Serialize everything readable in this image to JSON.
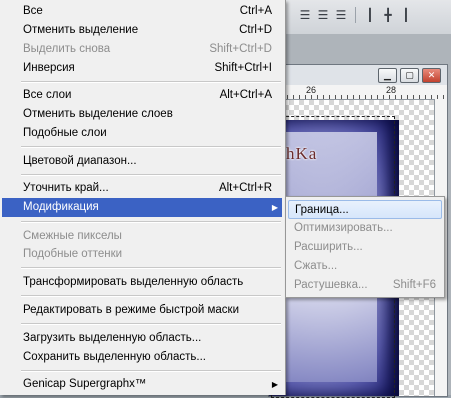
{
  "toolbar": {
    "icons": [
      "align-top-edges-icon",
      "align-vertical-centers-icon",
      "align-bottom-edges-icon",
      "align-left-edges-icon",
      "align-horizontal-centers-icon",
      "align-right-edges-icon"
    ]
  },
  "document": {
    "ruler_marks": [
      "26",
      "28"
    ],
    "watermark": "MimoZochKa"
  },
  "menu": {
    "items": [
      {
        "label": "Все",
        "shortcut": "Ctrl+A",
        "enabled": true
      },
      {
        "label": "Отменить выделение",
        "shortcut": "Ctrl+D",
        "enabled": true
      },
      {
        "label": "Выделить снова",
        "shortcut": "Shift+Ctrl+D",
        "enabled": false
      },
      {
        "label": "Инверсия",
        "shortcut": "Shift+Ctrl+I",
        "enabled": true
      },
      {
        "label": "Все слои",
        "shortcut": "Alt+Ctrl+A",
        "enabled": true
      },
      {
        "label": "Отменить выделение слоев",
        "shortcut": "",
        "enabled": true
      },
      {
        "label": "Подобные слои",
        "shortcut": "",
        "enabled": true
      },
      {
        "label": "Цветовой диапазон...",
        "shortcut": "",
        "enabled": true
      },
      {
        "label": "Уточнить край...",
        "shortcut": "Alt+Ctrl+R",
        "enabled": true
      },
      {
        "label": "Модификация",
        "shortcut": "",
        "enabled": true,
        "submenu": true,
        "selected": true
      },
      {
        "label": "Смежные пикселы",
        "shortcut": "",
        "enabled": false
      },
      {
        "label": "Подобные оттенки",
        "shortcut": "",
        "enabled": false
      },
      {
        "label": "Трансформировать выделенную область",
        "shortcut": "",
        "enabled": true
      },
      {
        "label": "Редактировать в режиме быстрой маски",
        "shortcut": "",
        "enabled": true
      },
      {
        "label": "Загрузить выделенную область...",
        "shortcut": "",
        "enabled": true
      },
      {
        "label": "Сохранить выделенную область...",
        "shortcut": "",
        "enabled": true
      },
      {
        "label": "Genicap Supergraphx™",
        "shortcut": "",
        "enabled": true,
        "submenu": true
      }
    ]
  },
  "submenu": {
    "items": [
      {
        "label": "Граница...",
        "shortcut": "",
        "enabled": true,
        "hover": true
      },
      {
        "label": "Оптимизировать...",
        "shortcut": "",
        "enabled": false
      },
      {
        "label": "Расширить...",
        "shortcut": "",
        "enabled": false
      },
      {
        "label": "Сжать...",
        "shortcut": "",
        "enabled": false
      },
      {
        "label": "Растушевка...",
        "shortcut": "Shift+F6",
        "enabled": false
      }
    ]
  }
}
